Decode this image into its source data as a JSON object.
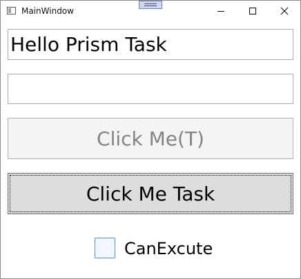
{
  "window": {
    "title": "MainWindow"
  },
  "caption_buttons": {
    "minimize_icon": "minimize-icon",
    "maximize_icon": "maximize-icon",
    "close_icon": "close-icon"
  },
  "main": {
    "message_text": "Hello Prism Task",
    "second_input_value": "",
    "click_me_t_label": "Click Me(T)",
    "click_me_task_label": "Click Me Task",
    "can_execute_label": "CanExcute",
    "can_execute_checked": false
  },
  "colors": {
    "checkbox_border": "#5a8cc7",
    "disabled_text": "#838383",
    "task_button_bg": "#dddddd"
  }
}
